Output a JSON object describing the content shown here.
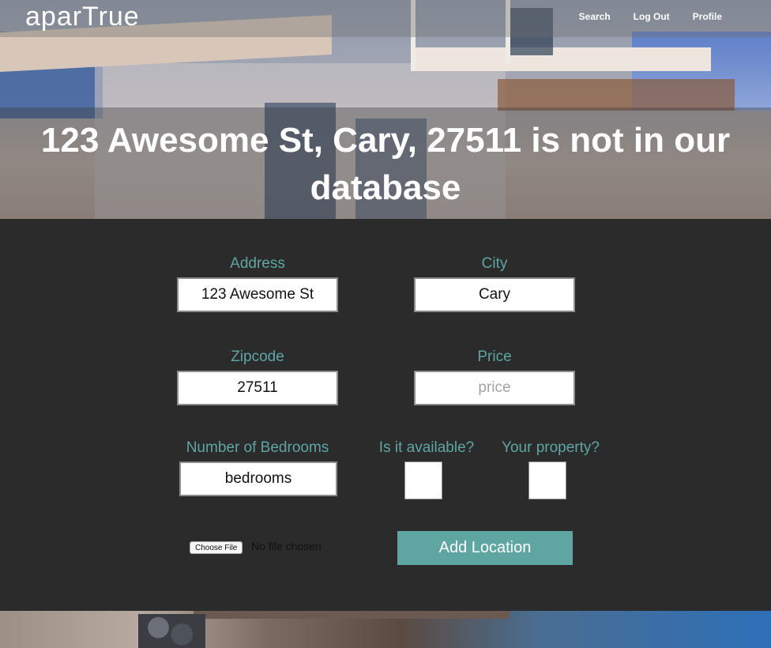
{
  "brand": "aparTrue",
  "nav": {
    "search": "Search",
    "logout": "Log Out",
    "profile": "Profile"
  },
  "headline": "123 Awesome St, Cary, 27511 is not in our database",
  "form": {
    "address": {
      "label": "Address",
      "value": "123 Awesome St"
    },
    "city": {
      "label": "City",
      "value": "Cary"
    },
    "zipcode": {
      "label": "Zipcode",
      "value": "27511"
    },
    "price": {
      "label": "Price",
      "placeholder": "price"
    },
    "bedrooms": {
      "label": "Number of Bedrooms",
      "value": "bedrooms"
    },
    "available": {
      "label": "Is it available?",
      "checked": false
    },
    "owner": {
      "label": "Your property?",
      "checked": false
    },
    "file": {
      "button": "Choose File",
      "status": "No file chosen"
    },
    "submit": "Add Location"
  }
}
